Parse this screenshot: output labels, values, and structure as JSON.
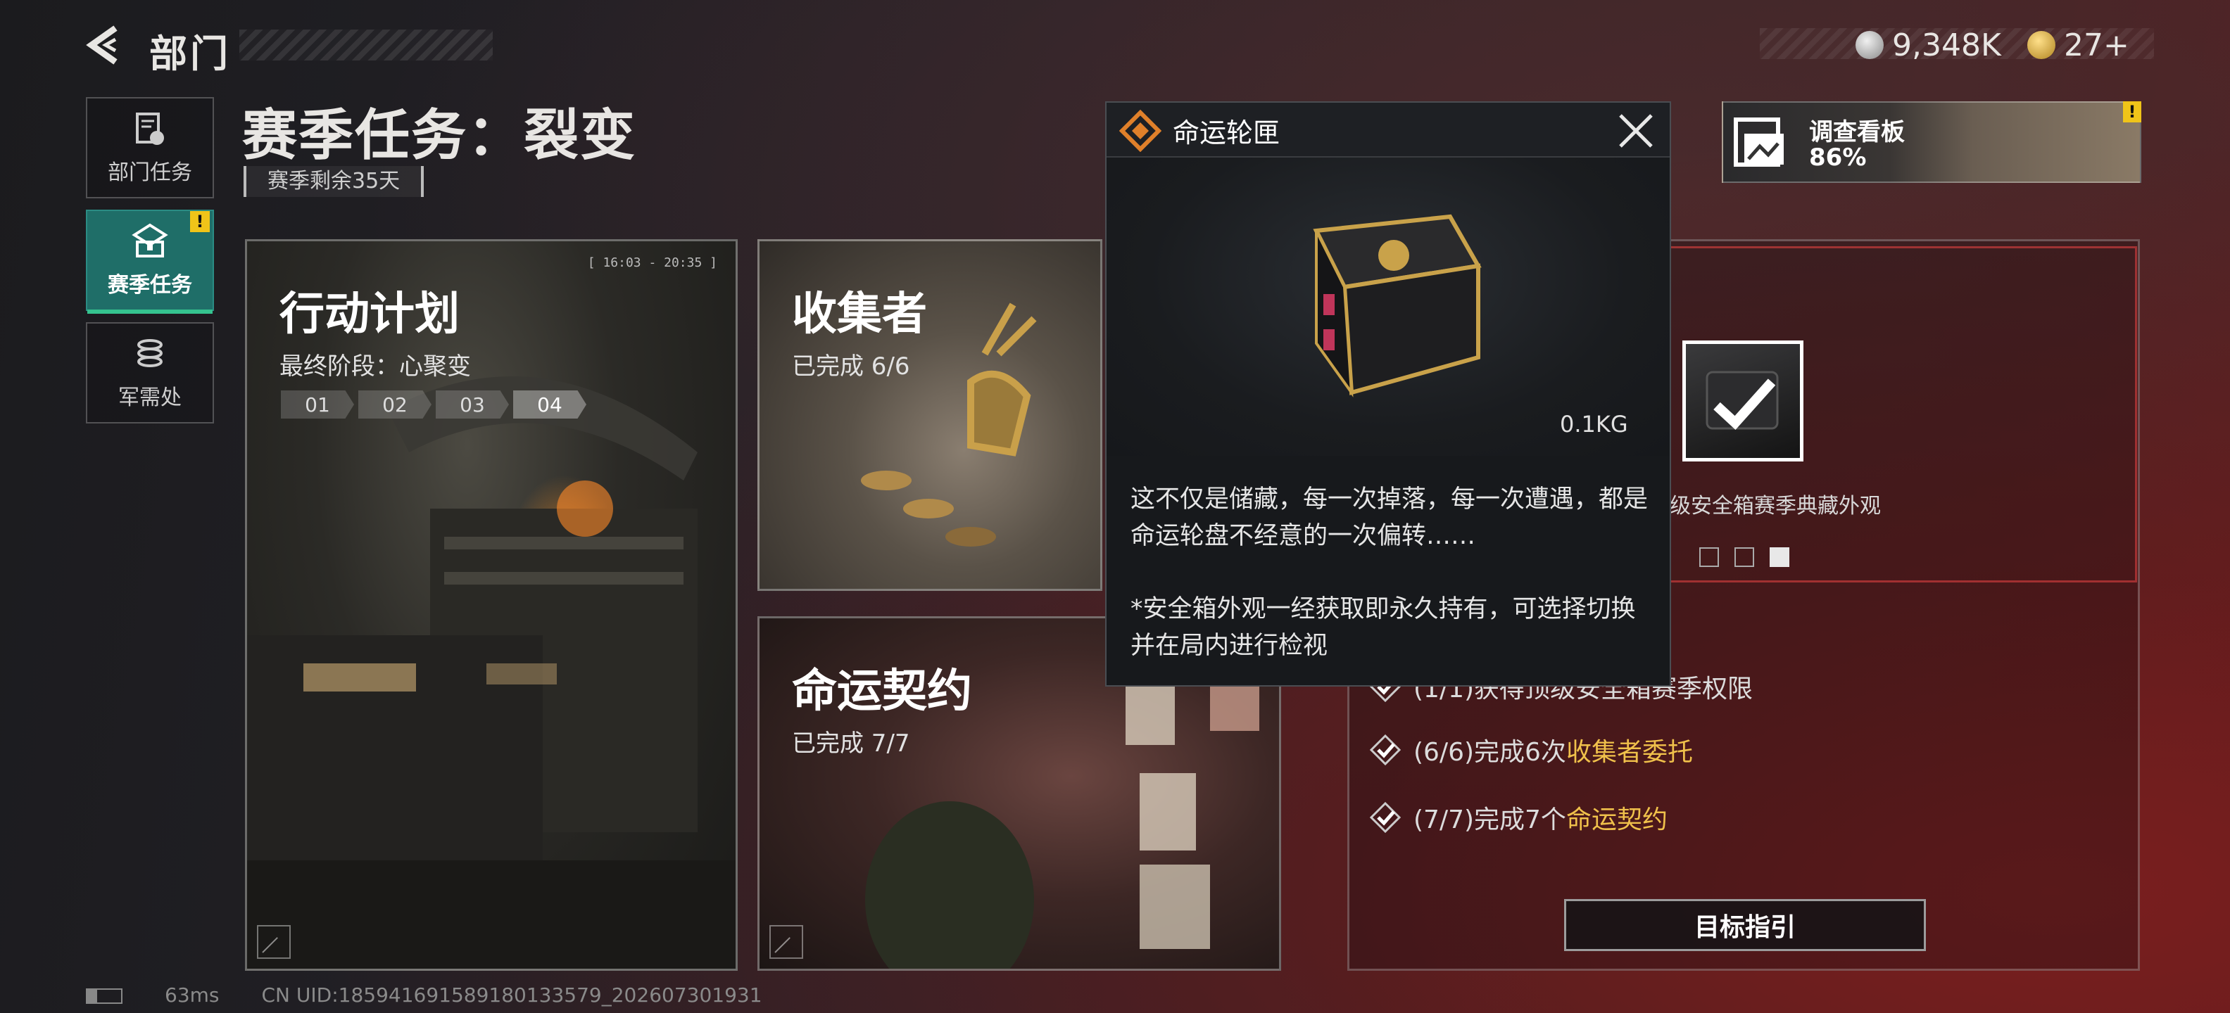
{
  "header": {
    "title": "部门"
  },
  "currency": [
    {
      "icon": "silver-coin-icon",
      "value": "9,348K",
      "color": "#c8c8c8"
    },
    {
      "icon": "gold-coin-icon",
      "value": "27+",
      "color": "#d4a935"
    }
  ],
  "nav": [
    {
      "label": "部门任务",
      "icon": "document-icon",
      "active": false
    },
    {
      "label": "赛季任务",
      "icon": "chest-icon",
      "active": true,
      "badge": "!"
    },
    {
      "label": "军需处",
      "icon": "coins-icon",
      "active": false
    }
  ],
  "season": {
    "title": "赛季任务：裂变",
    "remaining": "赛季剩余35天"
  },
  "cards": {
    "plan": {
      "title": "行动计划",
      "subtitle": "最终阶段：心聚变",
      "stages": [
        "01",
        "02",
        "03",
        "04"
      ],
      "timecode": "[ 16:03 - 20:35 ]"
    },
    "collector": {
      "title": "收集者",
      "subtitle": "已完成 6/6"
    },
    "fate": {
      "title": "命运契约",
      "subtitle": "已完成 7/7"
    }
  },
  "board": {
    "label": "调查看板",
    "percent": "86%",
    "badge": "!"
  },
  "reward": {
    "name_partial": "级安全箱赛季典藏外观"
  },
  "requirements": [
    {
      "prefix": "(1/1)获得顶级安全箱赛季权限",
      "highlight": ""
    },
    {
      "prefix": "(6/6)完成6次",
      "highlight": "收集者委托"
    },
    {
      "prefix": "(7/7)完成7个",
      "highlight": "命运契约"
    }
  ],
  "guide_button": "目标指引",
  "popup": {
    "title": "命运轮匣",
    "weight": "0.1KG",
    "desc1": "这不仅是储藏，每一次掉落，每一次遭遇，都是命运轮盘不经意的一次偏转……",
    "desc2": "*安全箱外观一经获取即永久持有，可选择切换并在局内进行检视"
  },
  "footer": {
    "ping": "63ms",
    "uid": "CN UID:185941691589180133579_202607301931"
  }
}
